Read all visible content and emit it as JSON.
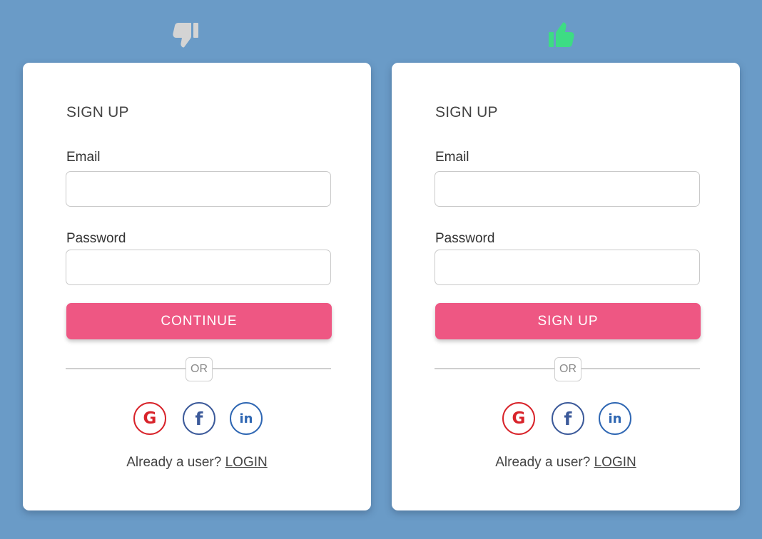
{
  "colors": {
    "background": "#6a9bc7",
    "thumbs_down": "#d4d4d4",
    "thumbs_up": "#3ddc84",
    "primary_button": "#ee5783",
    "google": "#d8232a",
    "facebook": "#3c5a9a",
    "linkedin": "#2f67b3"
  },
  "verdicts": {
    "left_icon": "thumbs-down-icon",
    "right_icon": "thumbs-up-icon"
  },
  "left_card": {
    "title": "SIGN UP",
    "email_label": "Email",
    "email_value": "",
    "password_label": "Password",
    "password_value": "",
    "button_label": "CONTINUE",
    "divider_text": "OR",
    "social": {
      "google": "G",
      "facebook": "f",
      "linkedin": "in"
    },
    "footer_text": "Already a user?",
    "login_label": "LOGIN"
  },
  "right_card": {
    "title": "SIGN UP",
    "email_label": "Email",
    "email_value": "",
    "password_label": "Password",
    "password_value": "",
    "button_label": "SIGN UP",
    "divider_text": "OR",
    "social": {
      "google": "G",
      "facebook": "f",
      "linkedin": "in"
    },
    "footer_text": "Already a user?",
    "login_label": "LOGIN"
  }
}
